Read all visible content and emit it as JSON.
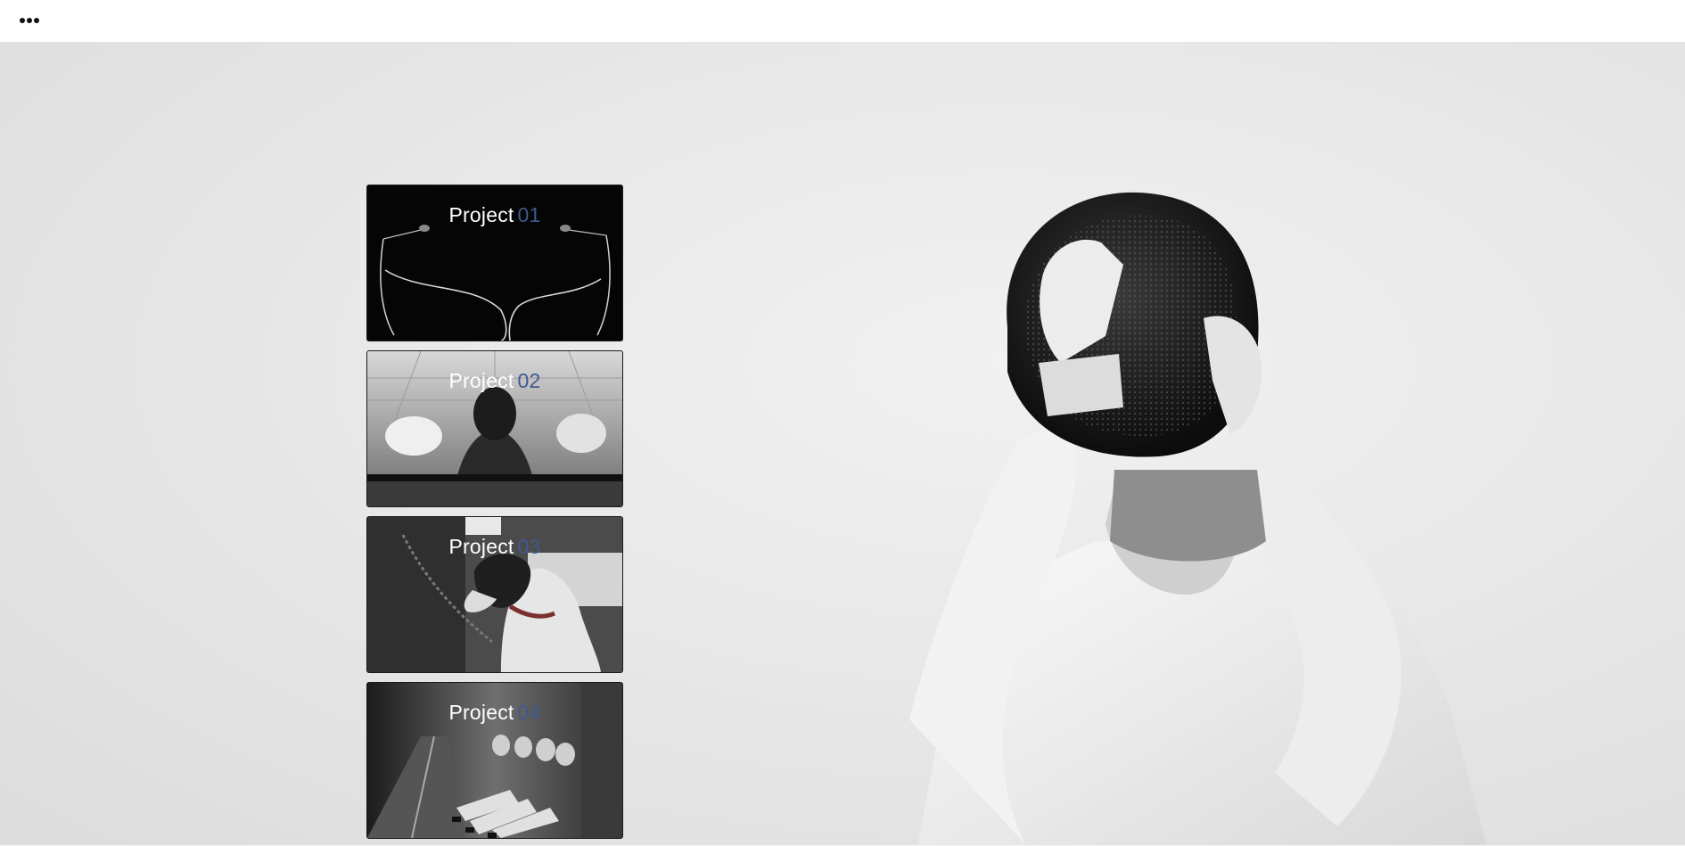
{
  "header": {
    "menu_icon": "more-horizontal-icon"
  },
  "projects": [
    {
      "word": "Project",
      "number": "01",
      "image": "earphones-photo"
    },
    {
      "word": "Project",
      "number": "02",
      "image": "boxer-photo"
    },
    {
      "word": "Project",
      "number": "03",
      "image": "dog-photo"
    },
    {
      "word": "Project",
      "number": "04",
      "image": "hallway-people-photo"
    }
  ],
  "hero": {
    "image": "fencer-photo"
  },
  "colors": {
    "number_accent": "#3f5a8e",
    "card_text": "#ffffff",
    "hero_bg": "#e6e6e6"
  }
}
